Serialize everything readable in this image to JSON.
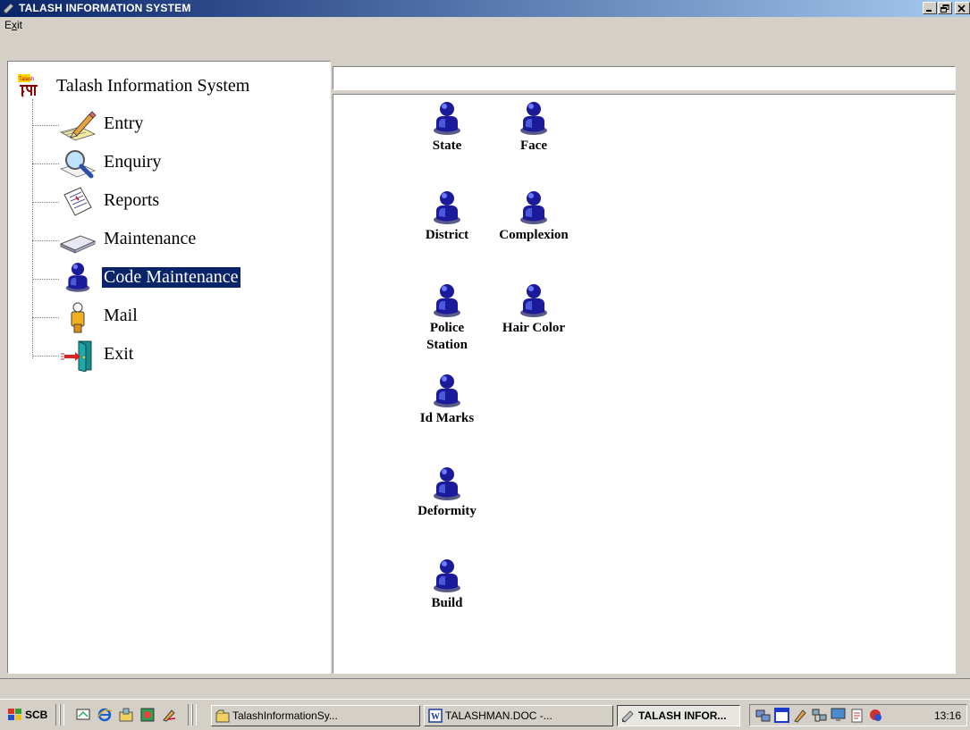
{
  "window": {
    "title": "TALASH INFORMATION SYSTEM"
  },
  "menu": {
    "items": [
      {
        "label": "Exit",
        "mnemonic": "x"
      }
    ]
  },
  "tree": {
    "root": "Talash Information System",
    "items": [
      {
        "label": "Entry",
        "icon": "pencil-pad-icon"
      },
      {
        "label": "Enquiry",
        "icon": "magnifier-icon"
      },
      {
        "label": "Reports",
        "icon": "report-document-icon"
      },
      {
        "label": "Maintenance",
        "icon": "tray-icon"
      },
      {
        "label": "Code Maintenance",
        "icon": "user-figure-icon",
        "selected": true
      },
      {
        "label": "Mail",
        "icon": "mailbox-icon"
      },
      {
        "label": "Exit",
        "icon": "exit-door-icon"
      }
    ]
  },
  "address": {
    "value": ""
  },
  "codes": [
    {
      "label": "State"
    },
    {
      "label": "Face"
    },
    {
      "label": "District"
    },
    {
      "label": "Complexion"
    },
    {
      "label": "Police Station"
    },
    {
      "label": "Hair Color"
    },
    {
      "label": "Id Marks"
    },
    {
      "label": "Deformity"
    },
    {
      "label": "Build"
    }
  ],
  "taskbar": {
    "start_label": "SCB",
    "tasks": [
      {
        "label": "TalashInformationSy..."
      },
      {
        "label": "TALASHMAN.DOC -..."
      },
      {
        "label": "TALASH INFOR...",
        "active": true
      }
    ],
    "clock": "13:16"
  },
  "colors": {
    "titlebar_start": "#0a246a",
    "titlebar_end": "#a6caf0",
    "selection": "#0a246a",
    "face": "#d4d0c8",
    "figure_blue": "#1a1a9a"
  }
}
